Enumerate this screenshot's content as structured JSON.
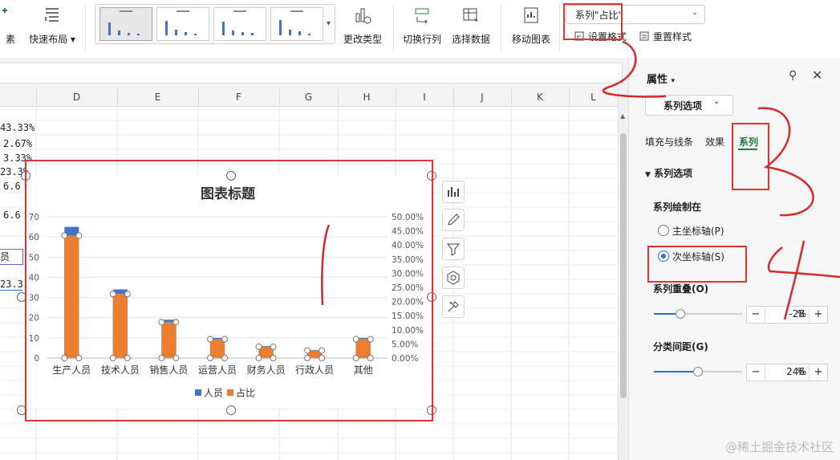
{
  "ribbon": {
    "elements_label": "素",
    "quick_layout_label": "快速布局",
    "change_type_label": "更改类型",
    "switch_row_col_label": "切换行列",
    "select_data_label": "选择数据",
    "move_chart_label": "移动图表",
    "series_select_value": "系列\"占比\"",
    "set_format_label": "设置格式",
    "reset_style_label": "重置样式"
  },
  "sheet": {
    "columns": [
      "D",
      "E",
      "F",
      "G",
      "H",
      "I",
      "J",
      "K",
      "L"
    ],
    "cells": [
      "43.33%",
      "2.67%",
      "3.33%",
      "23.3%",
      "6.6",
      "6.6",
      "员",
      "23.3"
    ]
  },
  "chart_data": {
    "type": "bar",
    "title": "图表标题",
    "categories": [
      "生产人员",
      "技术人员",
      "销售人员",
      "运营人员",
      "财务人员",
      "行政人员",
      "其他"
    ],
    "series": [
      {
        "name": "人员",
        "axis": "primary",
        "values": [
          65,
          34,
          19,
          10,
          6,
          4,
          10
        ],
        "color": "#4472c4"
      },
      {
        "name": "占比",
        "axis": "secondary",
        "values": [
          43.33,
          22.67,
          12.67,
          6.67,
          4.0,
          2.67,
          6.67
        ],
        "color": "#ed7d31"
      }
    ],
    "y_left": {
      "range": [
        0,
        70
      ],
      "ticks": [
        "0",
        "10",
        "20",
        "30",
        "40",
        "50",
        "60",
        "70"
      ]
    },
    "y_right": {
      "range": [
        0,
        50
      ],
      "ticks": [
        "0.00%",
        "5.00%",
        "10.00%",
        "15.00%",
        "20.00%",
        "25.00%",
        "30.00%",
        "35.00%",
        "40.00%",
        "45.00%",
        "50.00%"
      ]
    },
    "grid": true,
    "legend": "bottom"
  },
  "chart_tools": [
    "chart-elements-icon",
    "chart-style-icon",
    "chart-filter-icon",
    "chart-settings-icon",
    "quick-tools-icon"
  ],
  "pane": {
    "title": "属性",
    "dropdown_label": "系列选项",
    "tabs": [
      "填充与线条",
      "效果",
      "系列"
    ],
    "active_tab": "系列",
    "section_label": "系列选项",
    "plot_on_label": "系列绘制在",
    "primary_axis_label": "主坐标轴(P)",
    "secondary_axis_label": "次坐标轴(S)",
    "selected_axis": "secondary",
    "overlap_label": "系列重叠(O)",
    "overlap_value": "-28",
    "overlap_level": -0.28,
    "gap_label": "分类间距(G)",
    "gap_value": "246",
    "gap_level": 0.492,
    "unit": "%"
  },
  "annotations": [
    "1",
    "2",
    "3",
    "4"
  ],
  "watermark": "@稀土掘金技术社区",
  "colors": {
    "accent": "#2e6fd8",
    "annotation": "#e03434",
    "active_tab": "#1f7a3d"
  }
}
